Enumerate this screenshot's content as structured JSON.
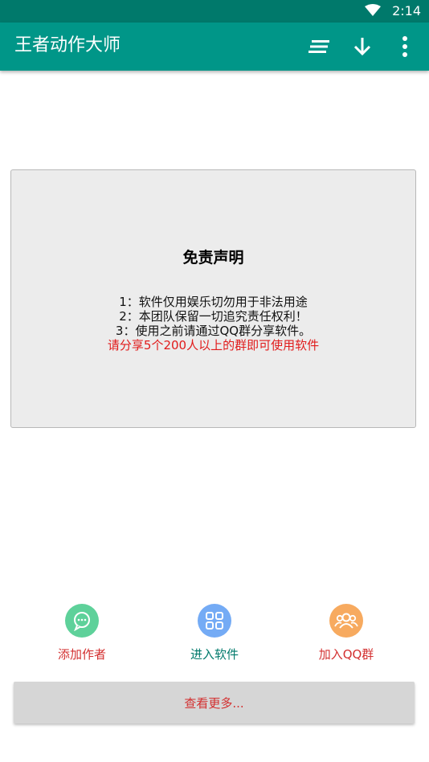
{
  "status_bar": {
    "time": "2:14"
  },
  "app_bar": {
    "title": "王者动作大师",
    "actions": [
      "sort-lines-icon",
      "arrow-down-icon",
      "more-vert-icon"
    ]
  },
  "disclaimer": {
    "heading": "免责声明",
    "line1": "1：软件仅用娱乐切勿用于非法用途",
    "line2": "2：本团队保留一切追究责任权利！",
    "line3": "3：使用之前请通过QQ群分享软件。",
    "warning": "请分享5个200人以上的群即可使用软件"
  },
  "quick_actions": [
    {
      "label": "添加作者",
      "icon": "chat-bubble-icon",
      "color": "#5ed19a",
      "label_color": "#d32f2f"
    },
    {
      "label": "进入软件",
      "icon": "apps-grid-icon",
      "color": "#74abf5",
      "label_color": "#00796b"
    },
    {
      "label": "加入QQ群",
      "icon": "group-icon",
      "color": "#f7aa5f",
      "label_color": "#d32f2f"
    }
  ],
  "more_button": {
    "label": "查看更多..."
  },
  "colors": {
    "primary": "#009688",
    "primary_dark": "#00796b",
    "accent_red": "#d32f2f"
  }
}
